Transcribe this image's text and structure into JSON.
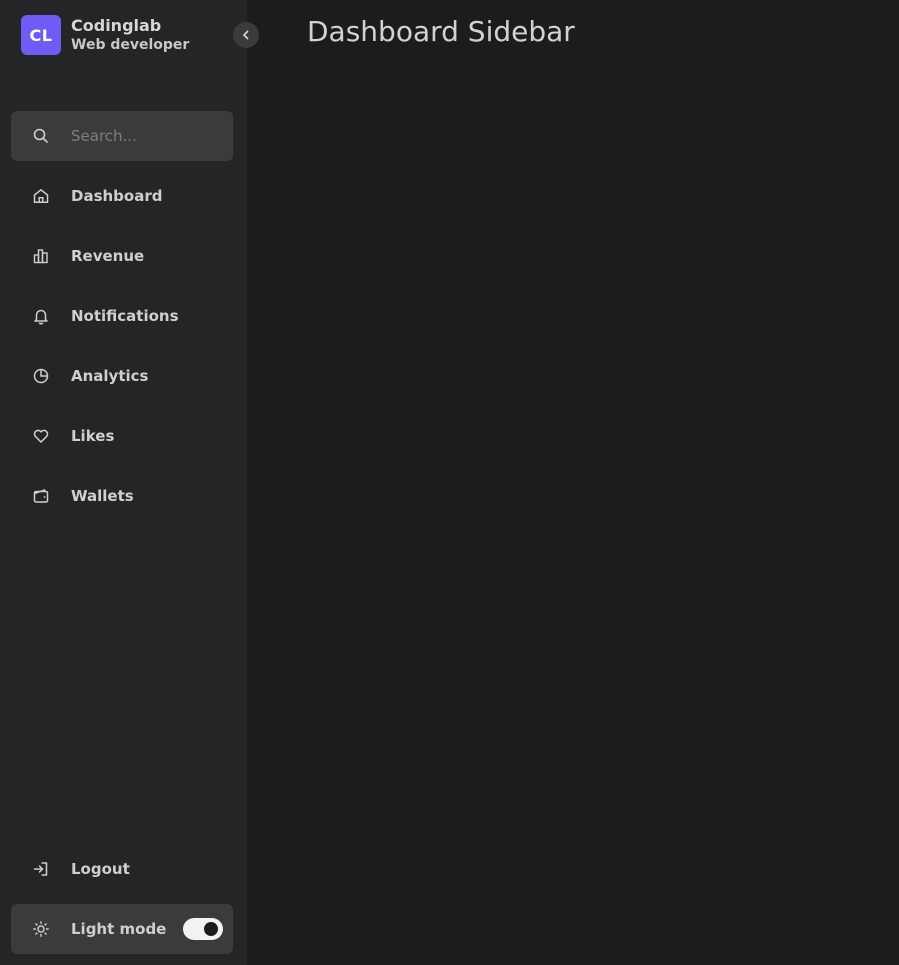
{
  "brand": {
    "logo_text": "CL",
    "name": "Codinglab",
    "role": "Web developer"
  },
  "search": {
    "placeholder": "Search..."
  },
  "nav": {
    "items": [
      {
        "label": "Dashboard",
        "icon": "home-icon"
      },
      {
        "label": "Revenue",
        "icon": "bar-chart-icon"
      },
      {
        "label": "Notifications",
        "icon": "bell-icon"
      },
      {
        "label": "Analytics",
        "icon": "pie-chart-icon"
      },
      {
        "label": "Likes",
        "icon": "heart-icon"
      },
      {
        "label": "Wallets",
        "icon": "wallet-icon"
      }
    ]
  },
  "bottom": {
    "logout_label": "Logout",
    "mode_label": "Light mode",
    "dark_mode_on": true
  },
  "main": {
    "title": "Dashboard Sidebar"
  },
  "colors": {
    "accent": "#6e5cf5",
    "sidebar_bg": "#242527",
    "page_bg": "#1b1c1e"
  }
}
